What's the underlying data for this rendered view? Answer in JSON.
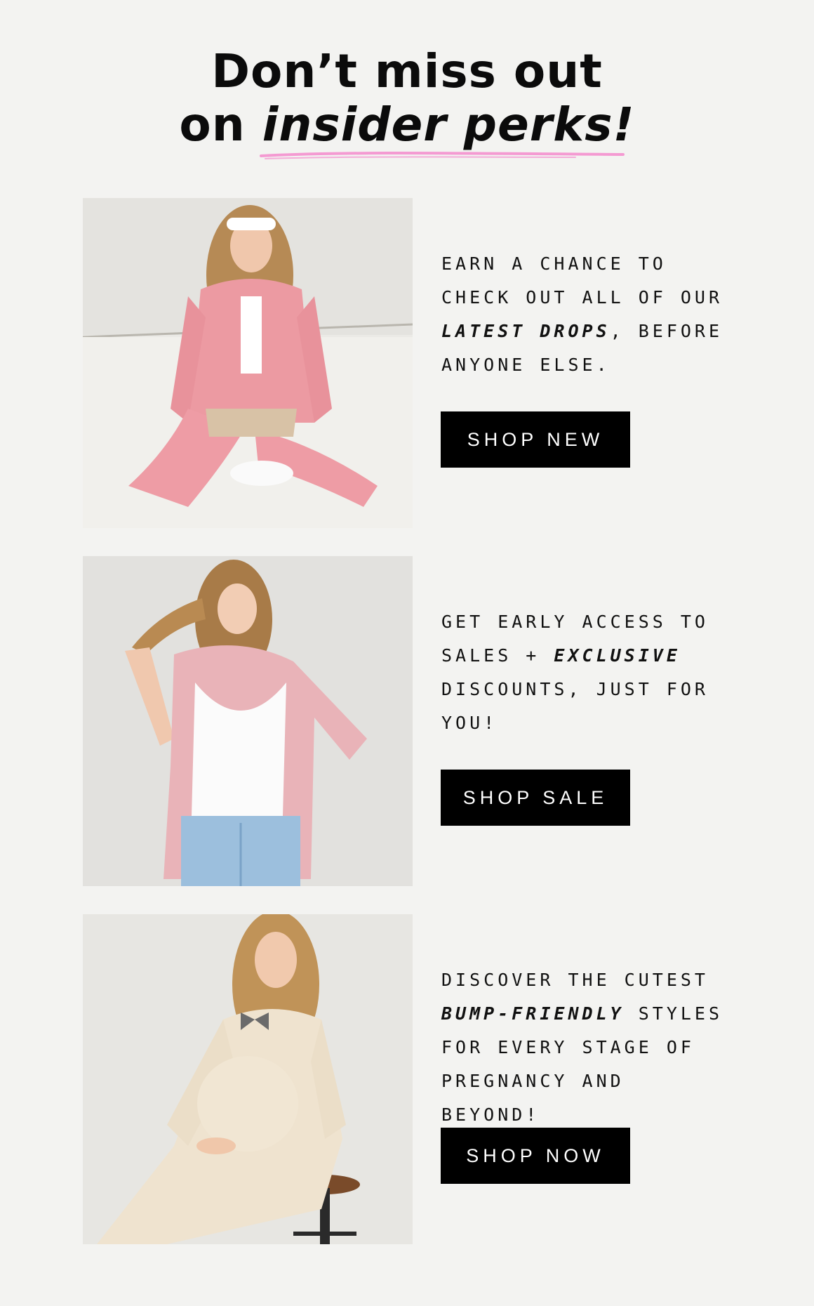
{
  "headline": {
    "line1": "Don’t miss out",
    "line2_prefix": "on ",
    "line2_emphasis": "insider perks!"
  },
  "accent_color": "#f49ad2",
  "perks": [
    {
      "copy_before": "Earn a chance to check out all of our ",
      "copy_emphasis": "latest drops",
      "copy_after": ", before anyone else.",
      "button_label": "SHOP NEW",
      "photo_icon": "model-pink-velour-tracksuit-photo"
    },
    {
      "copy_before": "Get early access to sales + ",
      "copy_emphasis": "exclusive",
      "copy_after": " discounts, just for you!",
      "button_label": "SHOP SALE",
      "photo_icon": "model-pink-striped-shirt-photo"
    },
    {
      "copy_before": "Discover the cutest ",
      "copy_emphasis": "bump-friendly",
      "copy_after": " styles for every stage of pregnancy and beyond!",
      "button_label": "SHOP NOW",
      "photo_icon": "model-cream-knit-dress-photo"
    }
  ]
}
